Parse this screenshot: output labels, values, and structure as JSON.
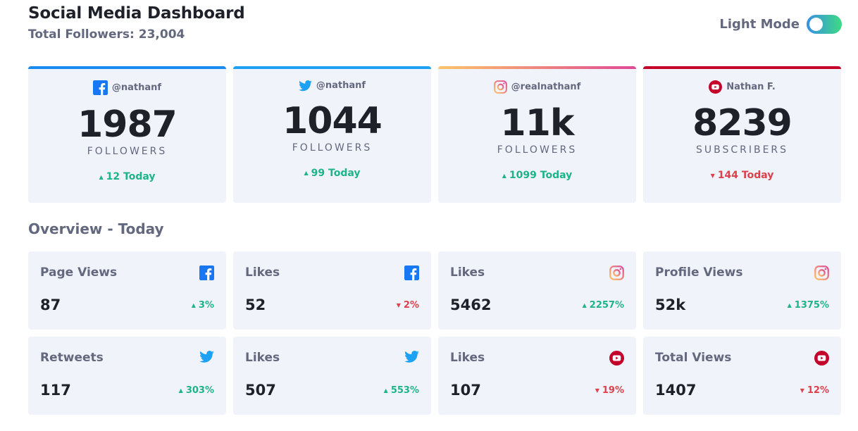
{
  "header": {
    "title": "Social Media Dashboard",
    "total_followers": "Total Followers: 23,004"
  },
  "theme_toggle": {
    "label": "Light Mode"
  },
  "colors": {
    "facebook": "#1877f2",
    "twitter": "#1da1f2",
    "instagram_start": "#fdc468",
    "instagram_end": "#df4996",
    "youtube": "#c4032a",
    "up": "#1db489",
    "down": "#dc414c"
  },
  "cards": [
    {
      "platform": "facebook",
      "icon": "facebook-icon",
      "handle": "@nathanf",
      "count": "1987",
      "unit": "FOLLOWERS",
      "delta": "12 Today",
      "direction": "up"
    },
    {
      "platform": "twitter",
      "icon": "twitter-icon",
      "handle": "@nathanf",
      "count": "1044",
      "unit": "FOLLOWERS",
      "delta": "99 Today",
      "direction": "up"
    },
    {
      "platform": "instagram",
      "icon": "instagram-icon",
      "handle": "@realnathanf",
      "count": "11k",
      "unit": "FOLLOWERS",
      "delta": "1099 Today",
      "direction": "up"
    },
    {
      "platform": "youtube",
      "icon": "youtube-icon",
      "handle": "Nathan F.",
      "count": "8239",
      "unit": "SUBSCRIBERS",
      "delta": "144 Today",
      "direction": "down"
    }
  ],
  "overview": {
    "title": "Overview - Today",
    "tiles": [
      {
        "label": "Page Views",
        "icon": "facebook-icon",
        "value": "87",
        "delta": "3%",
        "direction": "up"
      },
      {
        "label": "Likes",
        "icon": "facebook-icon",
        "value": "52",
        "delta": "2%",
        "direction": "down"
      },
      {
        "label": "Likes",
        "icon": "instagram-icon",
        "value": "5462",
        "delta": "2257%",
        "direction": "up"
      },
      {
        "label": "Profile Views",
        "icon": "instagram-icon",
        "value": "52k",
        "delta": "1375%",
        "direction": "up"
      },
      {
        "label": "Retweets",
        "icon": "twitter-icon",
        "value": "117",
        "delta": "303%",
        "direction": "up"
      },
      {
        "label": "Likes",
        "icon": "twitter-icon",
        "value": "507",
        "delta": "553%",
        "direction": "up"
      },
      {
        "label": "Likes",
        "icon": "youtube-icon",
        "value": "107",
        "delta": "19%",
        "direction": "down"
      },
      {
        "label": "Total Views",
        "icon": "youtube-icon",
        "value": "1407",
        "delta": "12%",
        "direction": "down"
      }
    ]
  }
}
